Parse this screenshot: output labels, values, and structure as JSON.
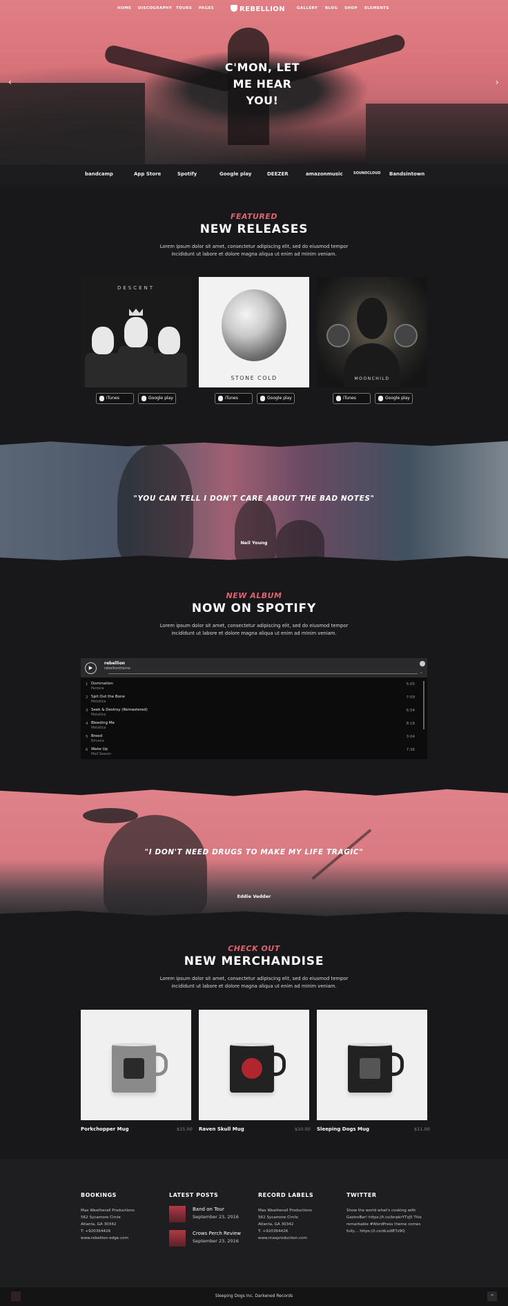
{
  "nav": {
    "left": [
      "HOME",
      "DISCOGRAPHY",
      "TOURS",
      "PAGES"
    ],
    "logo": "REBELLION",
    "right": [
      "GALLERY",
      "BLOG",
      "SHOP",
      "ELEMENTS"
    ]
  },
  "hero": {
    "title_line1": "C'MON, LET",
    "title_line2": "ME HEAR",
    "title_line3": "YOU!",
    "prev": "‹",
    "next": "›"
  },
  "partners": [
    "bandcamp",
    "App Store",
    "Spotify",
    "Google play",
    "DEEZER",
    "amazonmusic",
    "SOUNDCLOUD",
    "Bandsintown"
  ],
  "releases": {
    "kicker": "FEATURED",
    "title": "NEW RELEASES",
    "text_line1": "Lorem ipsum dolor sit amet, consectetur adipiscing elit, sed do eiusmod tempor",
    "text_line2": "incididunt ut labore et dolore magna aliqua ut enim ad minim veniam.",
    "albums": [
      {
        "cover_text": "DESCENT",
        "itunes": "iTunes",
        "google": "Google play"
      },
      {
        "cover_text": "STONE COLD",
        "itunes": "iTunes",
        "google": "Google play"
      },
      {
        "cover_text": "MOONCHILD",
        "itunes": "iTunes",
        "google": "Google play"
      }
    ]
  },
  "quote1": {
    "text": "\"YOU CAN TELL I DON'T CARE ABOUT THE BAD NOTES\"",
    "author": "Neil Young"
  },
  "spotify": {
    "kicker": "NEW ALBUM",
    "title": "NOW ON SPOTIFY",
    "text_line1": "Lorem ipsum dolor sit amet, consectetur adipiscing elit, sed do eiusmod tempor",
    "text_line2": "incididunt ut labore et dolore magna aliqua ut enim ad minim veniam.",
    "player_name": "rebellion",
    "player_user": "rebelliontheme",
    "tracks": [
      {
        "n": "1",
        "title": "Domination",
        "artist": "Pantera",
        "dur": "5:05"
      },
      {
        "n": "2",
        "title": "Spit Out the Bone",
        "artist": "Metallica",
        "dur": "7:09"
      },
      {
        "n": "3",
        "title": "Seek & Destroy (Remastered)",
        "artist": "Metallica",
        "dur": "6:54"
      },
      {
        "n": "4",
        "title": "Bleeding Me",
        "artist": "Metallica",
        "dur": "8:18"
      },
      {
        "n": "5",
        "title": "Breed",
        "artist": "Nirvana",
        "dur": "3:04"
      },
      {
        "n": "6",
        "title": "Wake Up",
        "artist": "Mad Season",
        "dur": "7:36"
      }
    ]
  },
  "quote2": {
    "text": "\"I DON'T NEED DRUGS TO MAKE MY LIFE TRAGIC\"",
    "author": "Eddie Vedder"
  },
  "merch": {
    "kicker": "CHECK OUT",
    "title": "NEW MERCHANDISE",
    "text_line1": "Lorem ipsum dolor sit amet, consectetur adipiscing elit, sed do eiusmod tempor",
    "text_line2": "incididunt ut labore et dolore magna aliqua ut enim ad minim veniam.",
    "products": [
      {
        "name": "Porkchopper Mug",
        "price": "$15.00"
      },
      {
        "name": "Raven Skull Mug",
        "price": "$10.00"
      },
      {
        "name": "Sleeping Dogs Mug",
        "price": "$11.00"
      }
    ]
  },
  "footer": {
    "bookings": {
      "title": "BOOKINGS",
      "lines": [
        "Max Weatherall Productions",
        "562 Sycamore Circle",
        "Atlanta, GA 30342",
        "T: +920364426",
        "www.rebellion-edge.com"
      ]
    },
    "posts": {
      "title": "LATEST POSTS",
      "items": [
        {
          "title": "Band on Tour",
          "date": "September 23, 2016"
        },
        {
          "title": "Crows Perch Review",
          "date": "September 23, 2016"
        }
      ]
    },
    "labels": {
      "title": "RECORD LABELS",
      "lines": [
        "Max Weatherall Productions",
        "562 Sycamore Circle",
        "Atlanta, GA 30342",
        "T: +920364426",
        "www.maxproduction.com"
      ]
    },
    "twitter": {
      "title": "TWITTER",
      "lines": [
        "Show the world what's cooking with",
        "GastroBar! https://t.co/bnpkrYTzJ5 This",
        "remarkable #WordPress theme comes",
        "fully… https://t.co/dLxdlETz9Q"
      ]
    },
    "copyright": "Sleeping Dogs Inc. Darkened Records",
    "to_top": "⌃"
  }
}
